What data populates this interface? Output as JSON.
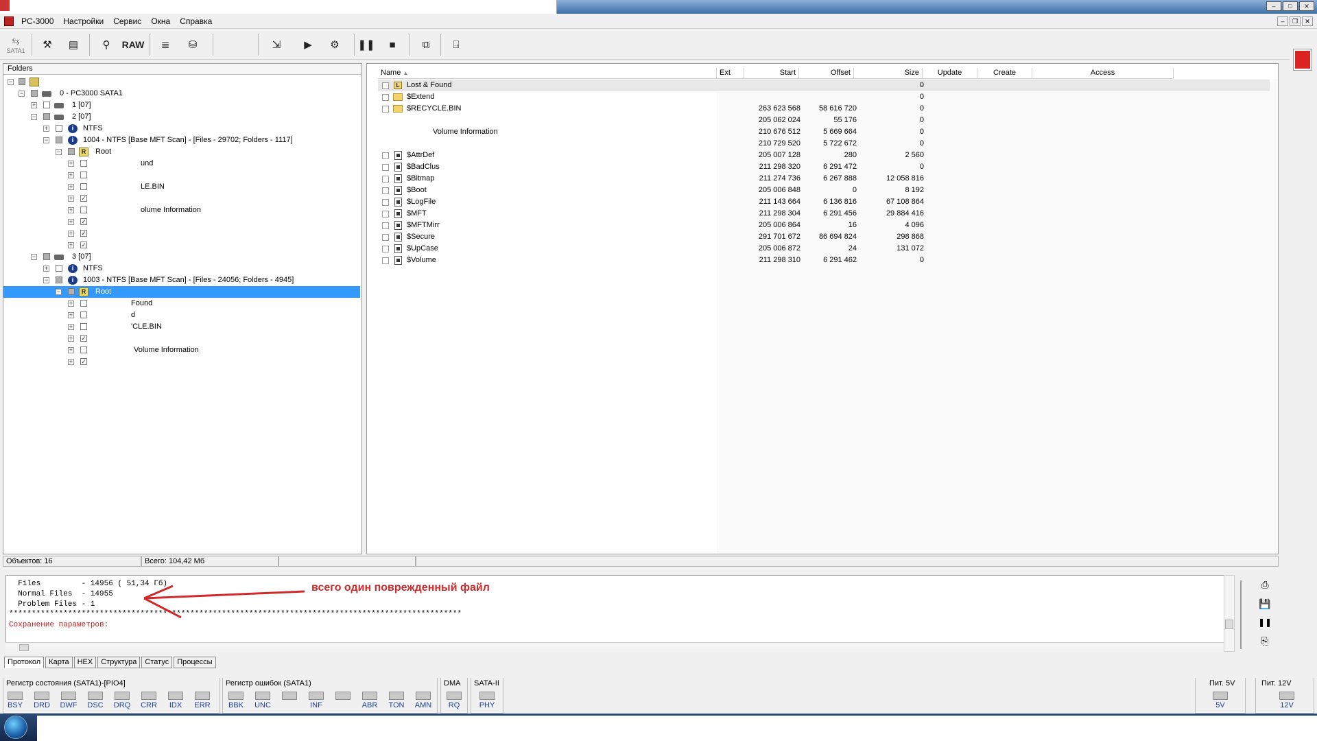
{
  "window": {
    "title": "PC-3000"
  },
  "menu": [
    "Настройки",
    "Сервис",
    "Окна",
    "Справка"
  ],
  "toolbar": {
    "sata_label": "SATA1",
    "raw_label": "RAW"
  },
  "folders": {
    "header": "Folders",
    "nodes": [
      {
        "label": "0 - PC3000 SATA1"
      },
      {
        "label": "1 [07]"
      },
      {
        "label": "2 [07]"
      },
      {
        "label": "NTFS"
      },
      {
        "label": "1004 - NTFS [Base MFT Scan] - [Files - 29702; Folders - 1117]"
      },
      {
        "label": "Root"
      },
      {
        "label": "und"
      },
      {
        "label": "LE.BIN"
      },
      {
        "label": "olume Information"
      },
      {
        "label": "3 [07]"
      },
      {
        "label": "NTFS"
      },
      {
        "label": "1003 - NTFS [Base MFT Scan] - [Files - 24056; Folders - 4945]"
      },
      {
        "label": "Root"
      },
      {
        "label": "Found"
      },
      {
        "label": "d"
      },
      {
        "label": "'CLE.BIN"
      },
      {
        "label": "Volume Information"
      }
    ]
  },
  "list": {
    "columns": [
      "Name",
      "Ext",
      "Start",
      "Offset",
      "Size",
      "Update",
      "Create",
      "Access"
    ],
    "rows": [
      {
        "name": "Lost & Found",
        "start": "",
        "offset": "",
        "size": "0"
      },
      {
        "name": "$Extend",
        "start": "",
        "offset": "",
        "size": "0"
      },
      {
        "name": "$RECYCLE.BIN",
        "start": "263 623 568",
        "offset": "58 616 720",
        "size": "0"
      },
      {
        "name": "",
        "start": "205 062 024",
        "offset": "55 176",
        "size": "0"
      },
      {
        "name": "Volume Information",
        "start": "210 676 512",
        "offset": "5 669 664",
        "size": "0"
      },
      {
        "name": "",
        "start": "210 729 520",
        "offset": "5 722 672",
        "size": "0"
      },
      {
        "name": "$AttrDef",
        "start": "205 007 128",
        "offset": "280",
        "size": "2 560"
      },
      {
        "name": "$BadClus",
        "start": "211 298 320",
        "offset": "6 291 472",
        "size": "0"
      },
      {
        "name": "$Bitmap",
        "start": "211 274 736",
        "offset": "6 267 888",
        "size": "12 058 816"
      },
      {
        "name": "$Boot",
        "start": "205 006 848",
        "offset": "0",
        "size": "8 192"
      },
      {
        "name": "$LogFile",
        "start": "211 143 664",
        "offset": "6 136 816",
        "size": "67 108 864"
      },
      {
        "name": "$MFT",
        "start": "211 298 304",
        "offset": "6 291 456",
        "size": "29 884 416"
      },
      {
        "name": "$MFTMirr",
        "start": "205 006 864",
        "offset": "16",
        "size": "4 096"
      },
      {
        "name": "$Secure",
        "start": "291 701 672",
        "offset": "86 694 824",
        "size": "298 868"
      },
      {
        "name": "$UpCase",
        "start": "205 006 872",
        "offset": "24",
        "size": "131 072"
      },
      {
        "name": "$Volume",
        "start": "211 298 310",
        "offset": "6 291 462",
        "size": "0"
      }
    ]
  },
  "status": {
    "objects": "Объектов: 16",
    "total": "Всего: 104,42 Мб"
  },
  "log": {
    "lines": [
      "  Files         - 14956 ( 51,34 Гб)",
      "  Normal Files  - 14955",
      "  Problem Files - 1",
      "****************************************************************************************************"
    ],
    "saving": "Сохранение параметров:",
    "annotation": "всего один поврежденный файл"
  },
  "tabs": [
    "Протокол",
    "Карта",
    "HEX",
    "Структура",
    "Статус",
    "Процессы"
  ],
  "registers": {
    "status_title": "Регистр состояния (SATA1)-[PIO4]",
    "status_leds": [
      "BSY",
      "DRD",
      "DWF",
      "DSC",
      "DRQ",
      "CRR",
      "IDX",
      "ERR"
    ],
    "error_title": "Регистр ошибок  (SATA1)",
    "error_leds": [
      "BBK",
      "UNC",
      "",
      "INF",
      "",
      "ABR",
      "TON",
      "AMN"
    ],
    "dma_title": "DMA",
    "dma_leds": [
      "RQ"
    ],
    "sata_title": "SATA-II",
    "sata_leds": [
      "PHY"
    ],
    "p5_title": "Пит. 5V",
    "p5_led": "5V",
    "p12_title": "Пит. 12V",
    "p12_led": "12V"
  }
}
